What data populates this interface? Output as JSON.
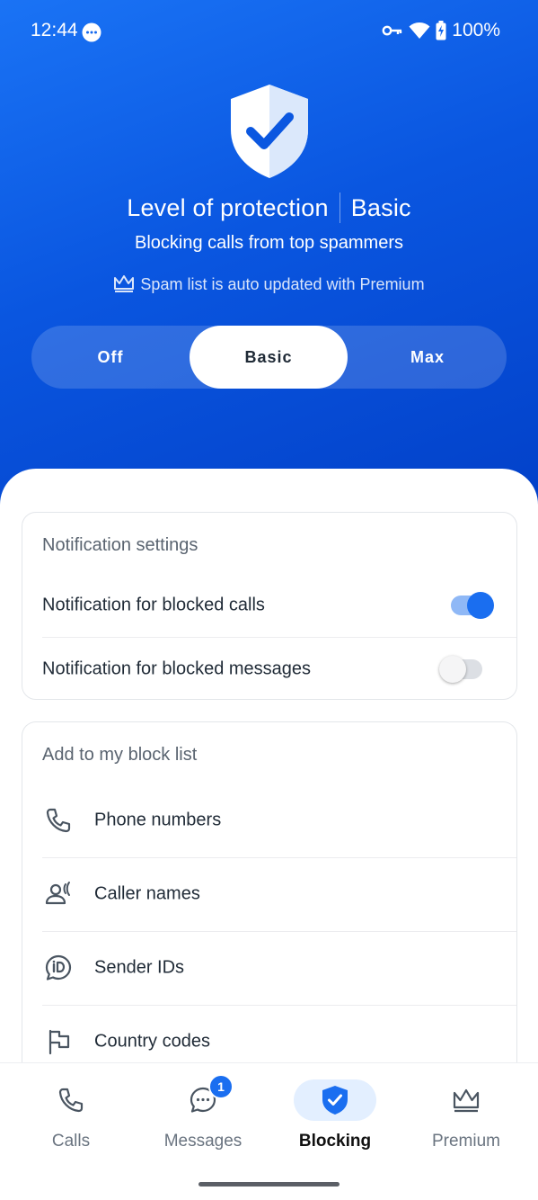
{
  "status": {
    "time": "12:44",
    "battery": "100%"
  },
  "hero": {
    "level_label": "Level of protection",
    "level_value": "Basic",
    "subtitle": "Blocking calls from top spammers",
    "premium_note": "Spam list is auto updated with Premium",
    "segments": [
      "Off",
      "Basic",
      "Max"
    ],
    "selected_segment": "Basic"
  },
  "notification_settings": {
    "title": "Notification settings",
    "items": [
      {
        "label": "Notification for blocked calls",
        "enabled": true
      },
      {
        "label": "Notification for blocked messages",
        "enabled": false
      }
    ]
  },
  "block_list": {
    "title": "Add to my block list",
    "items": [
      {
        "label": "Phone numbers",
        "icon": "phone-icon"
      },
      {
        "label": "Caller names",
        "icon": "caller-name-icon"
      },
      {
        "label": "Sender IDs",
        "icon": "sender-id-icon"
      },
      {
        "label": "Country codes",
        "icon": "flag-icon"
      }
    ]
  },
  "nav": {
    "items": [
      {
        "label": "Calls",
        "icon": "phone-icon"
      },
      {
        "label": "Messages",
        "icon": "chat-icon",
        "badge": "1"
      },
      {
        "label": "Blocking",
        "icon": "shield-check-icon"
      },
      {
        "label": "Premium",
        "icon": "crown-icon"
      }
    ],
    "active": "Blocking"
  },
  "colors": {
    "accent": "#1a6ef0",
    "hero_bg": "#0a56e0"
  }
}
